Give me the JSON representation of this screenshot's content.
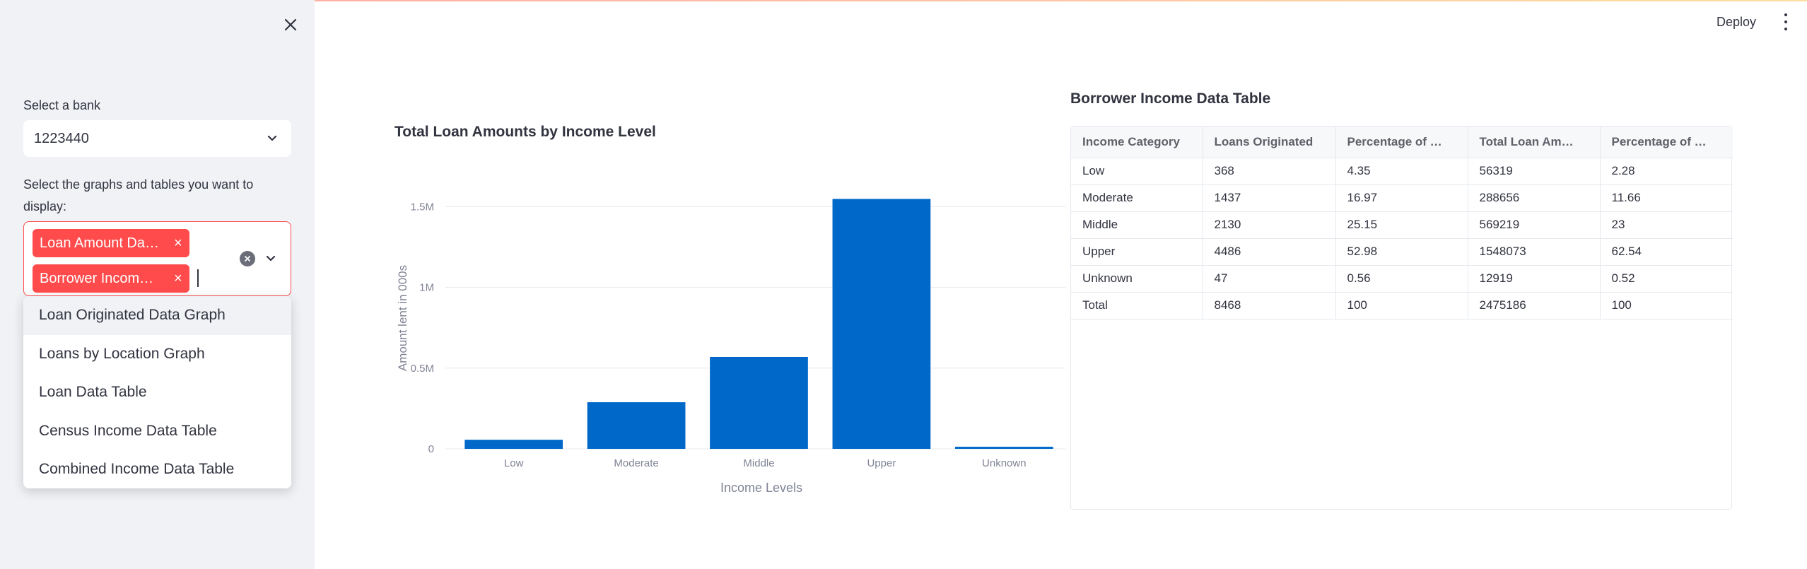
{
  "header": {
    "deploy_label": "Deploy"
  },
  "sidebar": {
    "bank_label": "Select a bank",
    "bank_value": "1223440",
    "graphs_label_line1": "Select the graphs and tables you want to",
    "graphs_label_line2": "display:",
    "selected_tags": [
      "Loan Amount Da…",
      "Borrower Incom…"
    ],
    "dropdown_options": [
      "Loan Originated Data Graph",
      "Loans by Location Graph",
      "Loan Data Table",
      "Census Income Data Table",
      "Combined Income Data Table"
    ]
  },
  "chart": {
    "title": "Total Loan Amounts by Income Level",
    "ytick_labels": [
      "0",
      "0.5M",
      "1M",
      "1.5M"
    ]
  },
  "chart_data": {
    "type": "bar",
    "title": "Total Loan Amounts by Income Level",
    "xlabel": "Income Levels",
    "ylabel": "Amount lent in 000s",
    "categories": [
      "Low",
      "Moderate",
      "Middle",
      "Upper",
      "Unknown"
    ],
    "values": [
      56319,
      288656,
      569219,
      1548073,
      12919
    ],
    "ylim": [
      0,
      1620000
    ],
    "yticks": [
      0,
      500000,
      1000000,
      1500000
    ],
    "grid": true,
    "color": "#0068c9"
  },
  "table": {
    "title": "Borrower Income Data Table",
    "columns": [
      "Income Category",
      "Loans Originated",
      "Percentage of …",
      "Total Loan Am…",
      "Percentage of …"
    ],
    "rows": [
      [
        "Low",
        "368",
        "4.35",
        "56319",
        "2.28"
      ],
      [
        "Moderate",
        "1437",
        "16.97",
        "288656",
        "11.66"
      ],
      [
        "Middle",
        "2130",
        "25.15",
        "569219",
        "23"
      ],
      [
        "Upper",
        "4486",
        "52.98",
        "1548073",
        "62.54"
      ],
      [
        "Unknown",
        "47",
        "0.56",
        "12919",
        "0.52"
      ],
      [
        "Total",
        "8468",
        "100",
        "2475186",
        "100"
      ]
    ]
  },
  "colors": {
    "accent": "#ff4b4b",
    "bar": "#0068c9",
    "sidebar_bg": "#f0f2f6"
  }
}
